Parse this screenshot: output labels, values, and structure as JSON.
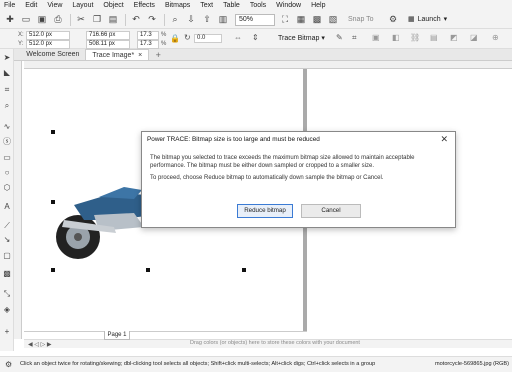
{
  "menu": {
    "items": [
      "File",
      "Edit",
      "View",
      "Layout",
      "Object",
      "Effects",
      "Bitmaps",
      "Text",
      "Table",
      "Tools",
      "Window",
      "Help"
    ]
  },
  "toolbar": {
    "zoom": "50%",
    "snap_to": "Snap To",
    "launch": "Launch"
  },
  "property_bar": {
    "x": "512.0 px",
    "y": "512.0 px",
    "width": "716.66 px",
    "height": "508.11 px",
    "scale_w": "17.3",
    "scale_h": "17.3",
    "pct": "%",
    "angle": "0.0",
    "trace_label": "Trace Bitmap"
  },
  "tabs": {
    "welcome": "Welcome Screen",
    "trace": "Trace Image*"
  },
  "page_tab": "Page 1",
  "color_hint": "Drag colors (or objects) here to store these colors with your document",
  "dialog": {
    "title": "Power TRACE: Bitmap size is too large and must be reduced",
    "paragraph1": "The bitmap you selected to trace exceeds the maximum bitmap size allowed to maintain acceptable performance. The bitmap must be either down sampled or cropped to a smaller size.",
    "paragraph2": "To proceed, choose Reduce bitmap to automatically down sample the bitmap or Cancel.",
    "reduce_label": "Reduce bitmap",
    "cancel_label": "Cancel"
  },
  "status": {
    "hint": "Click an object twice for rotating/skewing; dbl-clicking tool selects all objects; Shift+click multi-selects; Alt+click digs; Ctrl+click selects in a group",
    "file": "motorcycle-569865.jpg (RGB)"
  },
  "colors": {
    "accent": "#3b7bd4",
    "bike_blue": "#2f5f8a",
    "chrome": "#b8c0c8"
  }
}
